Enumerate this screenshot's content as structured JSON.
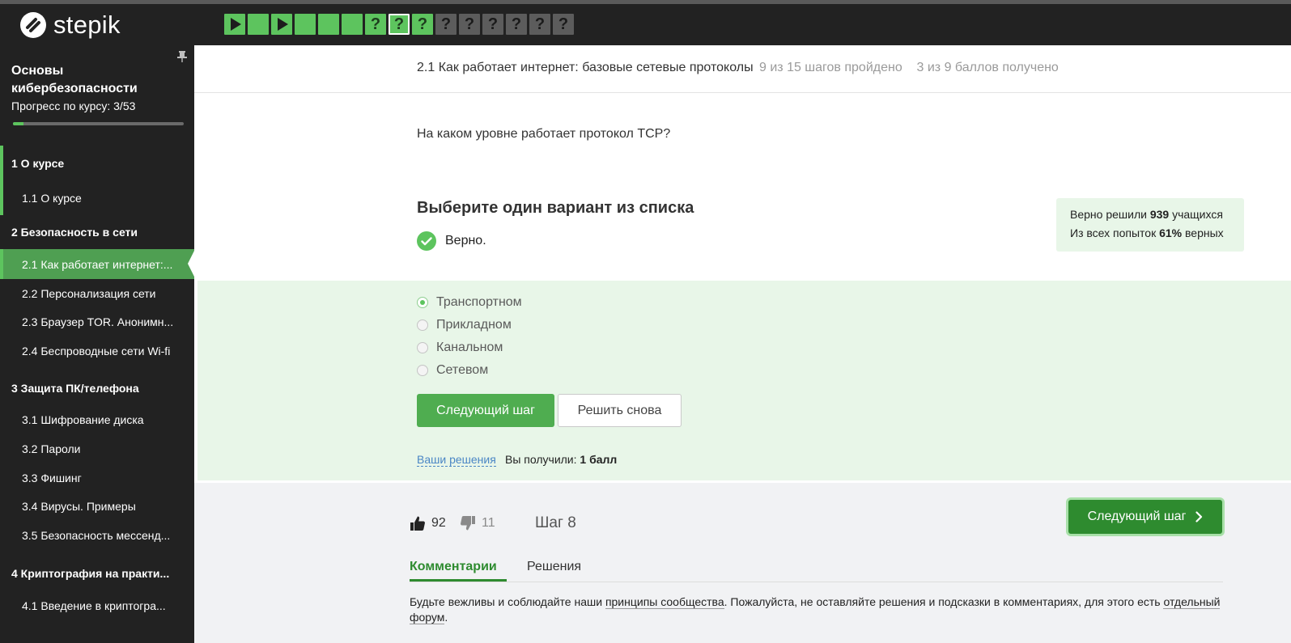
{
  "brand": {
    "name": "stepik"
  },
  "steps": [
    {
      "type": "play",
      "status": "done"
    },
    {
      "type": "text",
      "status": "done"
    },
    {
      "type": "play",
      "status": "done"
    },
    {
      "type": "text",
      "status": "done"
    },
    {
      "type": "text",
      "status": "done"
    },
    {
      "type": "text",
      "status": "done"
    },
    {
      "type": "quiz",
      "status": "done"
    },
    {
      "type": "quiz",
      "status": "done",
      "current": true
    },
    {
      "type": "quiz",
      "status": "done"
    },
    {
      "type": "quiz",
      "status": "pending"
    },
    {
      "type": "quiz",
      "status": "pending"
    },
    {
      "type": "quiz",
      "status": "pending"
    },
    {
      "type": "quiz",
      "status": "pending"
    },
    {
      "type": "quiz",
      "status": "pending"
    },
    {
      "type": "quiz",
      "status": "pending"
    }
  ],
  "sidebar": {
    "course_title": "Основы кибербезопасности",
    "progress_label": "Прогресс по курсу:  3/53",
    "progress_fraction": 0.06,
    "items": [
      {
        "label": "1  О курсе",
        "kind": "module"
      },
      {
        "label": "1.1  О курсе",
        "kind": "lesson"
      },
      {
        "label": "2  Безопасность в сети",
        "kind": "module"
      },
      {
        "label": "2.1  Как работает интернет:...",
        "kind": "lesson",
        "active": true
      },
      {
        "label": "2.2  Персонализация сети",
        "kind": "lesson"
      },
      {
        "label": "2.3  Браузер TOR. Анонимн...",
        "kind": "lesson"
      },
      {
        "label": "2.4  Беспроводные сети Wi-fi",
        "kind": "lesson"
      },
      {
        "label": "3  Защита ПК/телефона",
        "kind": "module"
      },
      {
        "label": "3.1  Шифрование диска",
        "kind": "lesson"
      },
      {
        "label": "3.2  Пароли",
        "kind": "lesson"
      },
      {
        "label": "3.3  Фишинг",
        "kind": "lesson"
      },
      {
        "label": "3.4  Вирусы. Примеры",
        "kind": "lesson"
      },
      {
        "label": "3.5  Безопасность мессенд...",
        "kind": "lesson"
      },
      {
        "label": "4  Криптография на практи...",
        "kind": "module"
      },
      {
        "label": "4.1  Введение в криптогра...",
        "kind": "lesson"
      }
    ]
  },
  "lesson": {
    "title": "2.1 Как работает интернет: базовые сетевые протоколы",
    "steps_passed": "9 из 15 шагов пройдено",
    "points": "3 из 9 баллов  получено"
  },
  "quiz": {
    "question": "На каком уровне работает протокол TCP?",
    "instruction": "Выберите один вариант из списка",
    "result": "Верно.",
    "stats": {
      "line1_prefix": "Верно решили ",
      "line1_value": "939",
      "line1_suffix": " учащихся",
      "line2_prefix": "Из всех попыток ",
      "line2_value": "61%",
      "line2_suffix": " верных"
    },
    "options": [
      {
        "label": "Транспортном",
        "selected": true
      },
      {
        "label": "Прикладном",
        "selected": false
      },
      {
        "label": "Канальном",
        "selected": false
      },
      {
        "label": "Сетевом",
        "selected": false
      }
    ],
    "next_button": "Следующий шаг",
    "retry_button": "Решить снова",
    "solutions_link": "Ваши решения",
    "score_prefix": "Вы получили: ",
    "score_value": "1 балл"
  },
  "footer": {
    "likes": "92",
    "dislikes": "11",
    "step_label": "Шаг 8",
    "next_button": "Следующий шаг",
    "tabs": [
      {
        "label": "Комментарии",
        "active": true
      },
      {
        "label": "Решения",
        "active": false
      }
    ],
    "rules": {
      "part1": "Будьте вежливы и соблюдайте наши ",
      "link1": "принципы сообщества",
      "part2": ". Пожалуйста, не оставляйте решения и подсказки в комментариях, для этого есть ",
      "link2": "отдельный форум",
      "part3": "."
    }
  },
  "colors": {
    "accent": "#5dc45e",
    "accent_dark": "#2e8b2f",
    "sidebar_bg": "#222222",
    "answer_bg": "#e8f6e8"
  }
}
